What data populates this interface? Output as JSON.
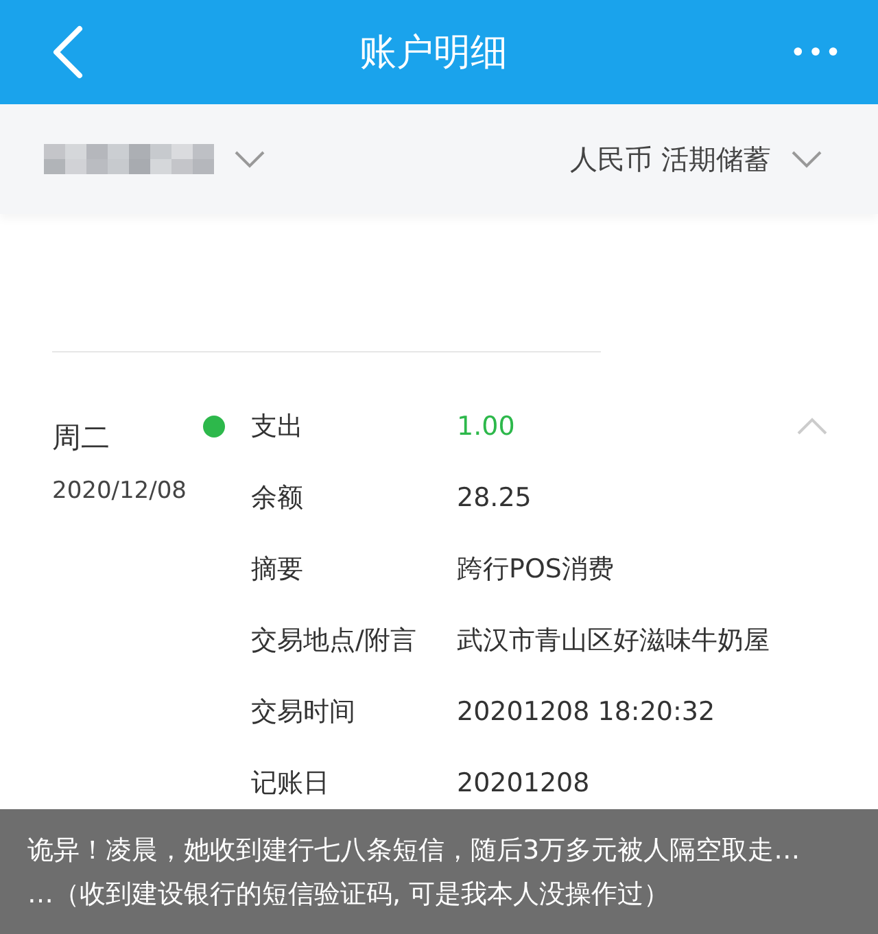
{
  "header": {
    "title": "账户明细",
    "more": "•••"
  },
  "filter": {
    "account_masked": true,
    "currency": "人民币 活期储蓄"
  },
  "transaction": {
    "weekday": "周二",
    "date": "2020/12/08",
    "expanded": true,
    "fields": [
      {
        "kind": "amount",
        "label": "支出",
        "value": "1.00"
      },
      {
        "kind": "text",
        "label": "余额",
        "value": "28.25"
      },
      {
        "kind": "text",
        "label": "摘要",
        "value": "跨行POS消费"
      },
      {
        "kind": "text",
        "label": "交易地点/附言",
        "value": "武汉市青山区好滋味牛奶屋"
      },
      {
        "kind": "text",
        "label": "交易时间",
        "value": "20201208 18:20:32"
      },
      {
        "kind": "text",
        "label": "记账日",
        "value": "20201208"
      }
    ]
  },
  "caption": {
    "line_1": "诡异！凌晨，她收到建行七八条短信，随后3万多元被人隔空取走…",
    "line_2": "…（收到建设银行的短信验证码, 可是我本人没操作过）"
  }
}
